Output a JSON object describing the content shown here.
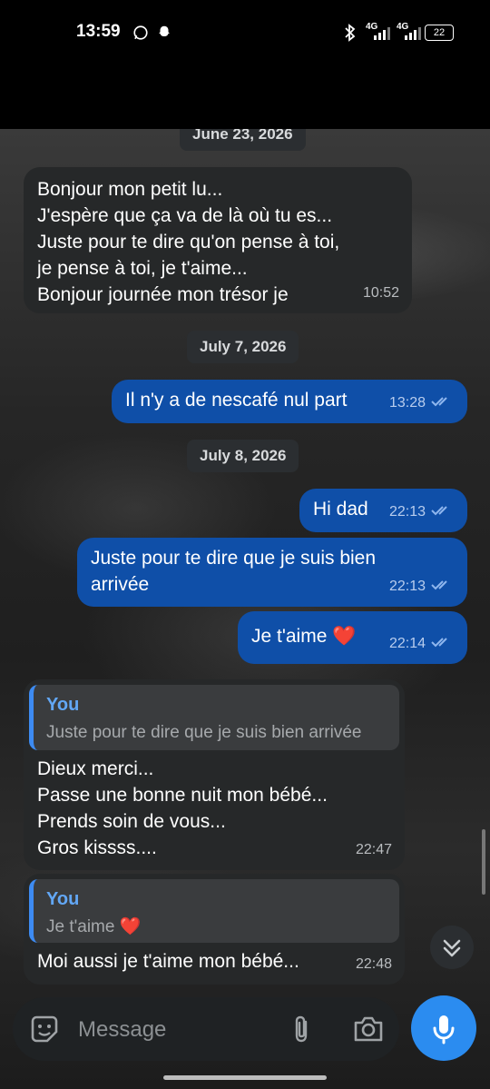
{
  "status_bar": {
    "time": "13:59",
    "network1": "4G",
    "network2": "4G",
    "battery": "22"
  },
  "header": {
    "contact_emoji": "👨"
  },
  "messages": {
    "date1": "June 23, 2026",
    "m1_text": "Bonjour mon petit lu...\nJ'espère que ça va de là où tu es...\nJuste pour te dire qu'on pense à toi,\nje pense à toi, je t'aime...\nBonjour journée mon trésor je",
    "m1_time": "10:52",
    "date2": "July 7, 2026",
    "m2_text": "Il n'y a de nescafé nul part",
    "m2_time": "13:28",
    "date3": "July 8, 2026",
    "m3_text": "Hi dad",
    "m3_time": "22:13",
    "m4_text": "Juste pour te dire que je suis bien\narrivée",
    "m4_time": "22:13",
    "m5_text": "Je t'aime ❤️",
    "m5_time": "22:14",
    "m6_reply_author": "You",
    "m6_reply_text": "Juste pour te dire que je suis bien arrivée",
    "m6_text": "Dieux merci...\nPasse une bonne nuit mon bébé...\nPrends soin de vous...\nGros kissss....",
    "m6_time": "22:47",
    "m7_reply_author": "You",
    "m7_reply_text": "Je t'aime ❤️",
    "m7_text": "Moi aussi je t'aime mon bébé...",
    "m7_time": "22:48"
  },
  "composer": {
    "placeholder": "Message"
  },
  "colors": {
    "outgoing": "#0f4fa8",
    "incoming": "#262829",
    "accent": "#2b8cf0"
  },
  "icons": [
    "back-arrow-icon",
    "video-call-icon",
    "phone-icon",
    "more-vert-icon",
    "double-check-icon",
    "chevron-double-down-icon",
    "sticker-icon",
    "paperclip-icon",
    "camera-icon",
    "mic-icon"
  ]
}
